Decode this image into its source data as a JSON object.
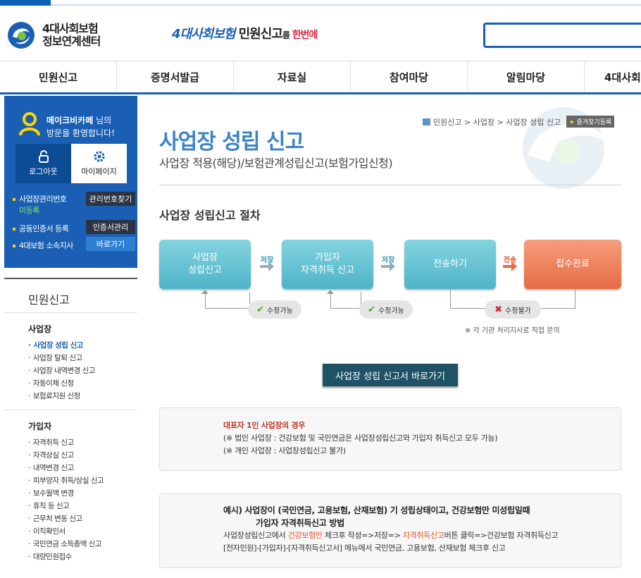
{
  "header": {
    "logo_line1": "4대사회보험",
    "logo_line2": "정보연계센터",
    "slogan_part1": "4대사회보험",
    "slogan_part2": " 민원신고",
    "slogan_part3": "를",
    "slogan_part4": " 한번에",
    "search_placeholder": ""
  },
  "gnb": [
    "민원신고",
    "증명서발급",
    "자료실",
    "참여마당",
    "알림마당",
    "4대사회"
  ],
  "user": {
    "name": "메이크비카페",
    "suffix": " 님의",
    "welcome": "방문을 환영합니다!",
    "logout": "로그아웃",
    "mypage": "마이페이지",
    "row1_label": "사업장관리번호",
    "row1_status": "미등록",
    "row1_button": "관리번호찾기",
    "row2_label": "공동인증서 등록",
    "row2_button": "인증서관리",
    "row3_label": "4대보험 소속지사",
    "row3_button": "바로가기"
  },
  "lnb": {
    "title": "민원신고",
    "group1_title": "사업장",
    "group1_items": [
      "사업장 성립 신고",
      "사업장 탈퇴 신고",
      "사업장 내역변경 신고",
      "자동이체 신청",
      "보험료지원 신청"
    ],
    "group2_title": "가입자",
    "group2_items": [
      "자격취득 신고",
      "자격상실 신고",
      "내역변경 신고",
      "피부양자 취득/상실 신고",
      "보수월액 변경",
      "휴직 등 신고",
      "근무처 변동 신고",
      "이직확인서",
      "국민연금 소득총액 신고",
      "대량민원접수"
    ]
  },
  "breadcrumb": {
    "b1": "민원신고",
    "b2": "사업장",
    "b3": "사업장 성립 신고",
    "fav": "즐겨찾기등록"
  },
  "main": {
    "title": "사업장 성립 신고",
    "subtitle": "사업장 적용(해당)/보험관계성립신고(보험가입신청)",
    "section_title": "사업장 성립신고 절차",
    "step1_l1": "사업장",
    "step1_l2": "성립신고",
    "step2_l1": "가입자",
    "step2_l2": "자격취득 신고",
    "step3": "전송하기",
    "step4": "접수완료",
    "arrow1": "저장",
    "arrow2": "저장",
    "arrow3": "전송",
    "pill1": "수정가능",
    "pill2": "수정가능",
    "pill3": "수정불가",
    "note": "※ 각 기관 처리지사로 직접 문의",
    "go_button": "사업장 성립 신고서 바로가기"
  },
  "box1": {
    "title": "대표자 1인 사업장의 경우",
    "line1": "(※ 법인 사업장 : 건강보험 및 국민연금은 사업장성립신고와 가입자 취득신고 모두 가능)",
    "line2": "(※ 개인 사업장 : 사업장성립신고 불가)"
  },
  "box2": {
    "title": "예시) 사업장이 (국민연금, 고용보험, 산재보험) 기 성립상태이고, 건강보험만 미성립일때",
    "title2": "가입자 자격취득신고 방법",
    "l1a": "사업장성립신고에서 ",
    "l1b": "건강보험만",
    "l1c": " 체크후 작성=>저장=> ",
    "l1d": "자격취득신고",
    "l1e": "버튼 클릭=>건강보험 자격취득신고",
    "line2": "[전자민원]-[가입자]-[자격취득신고서] 메뉴에서 국민연금, 고용보험, 산재보험 체크후 신고"
  },
  "colors": {
    "brand_blue": "#1a5fb4",
    "step_teal": "#4fb3c8",
    "step_orange": "#e66b45"
  }
}
